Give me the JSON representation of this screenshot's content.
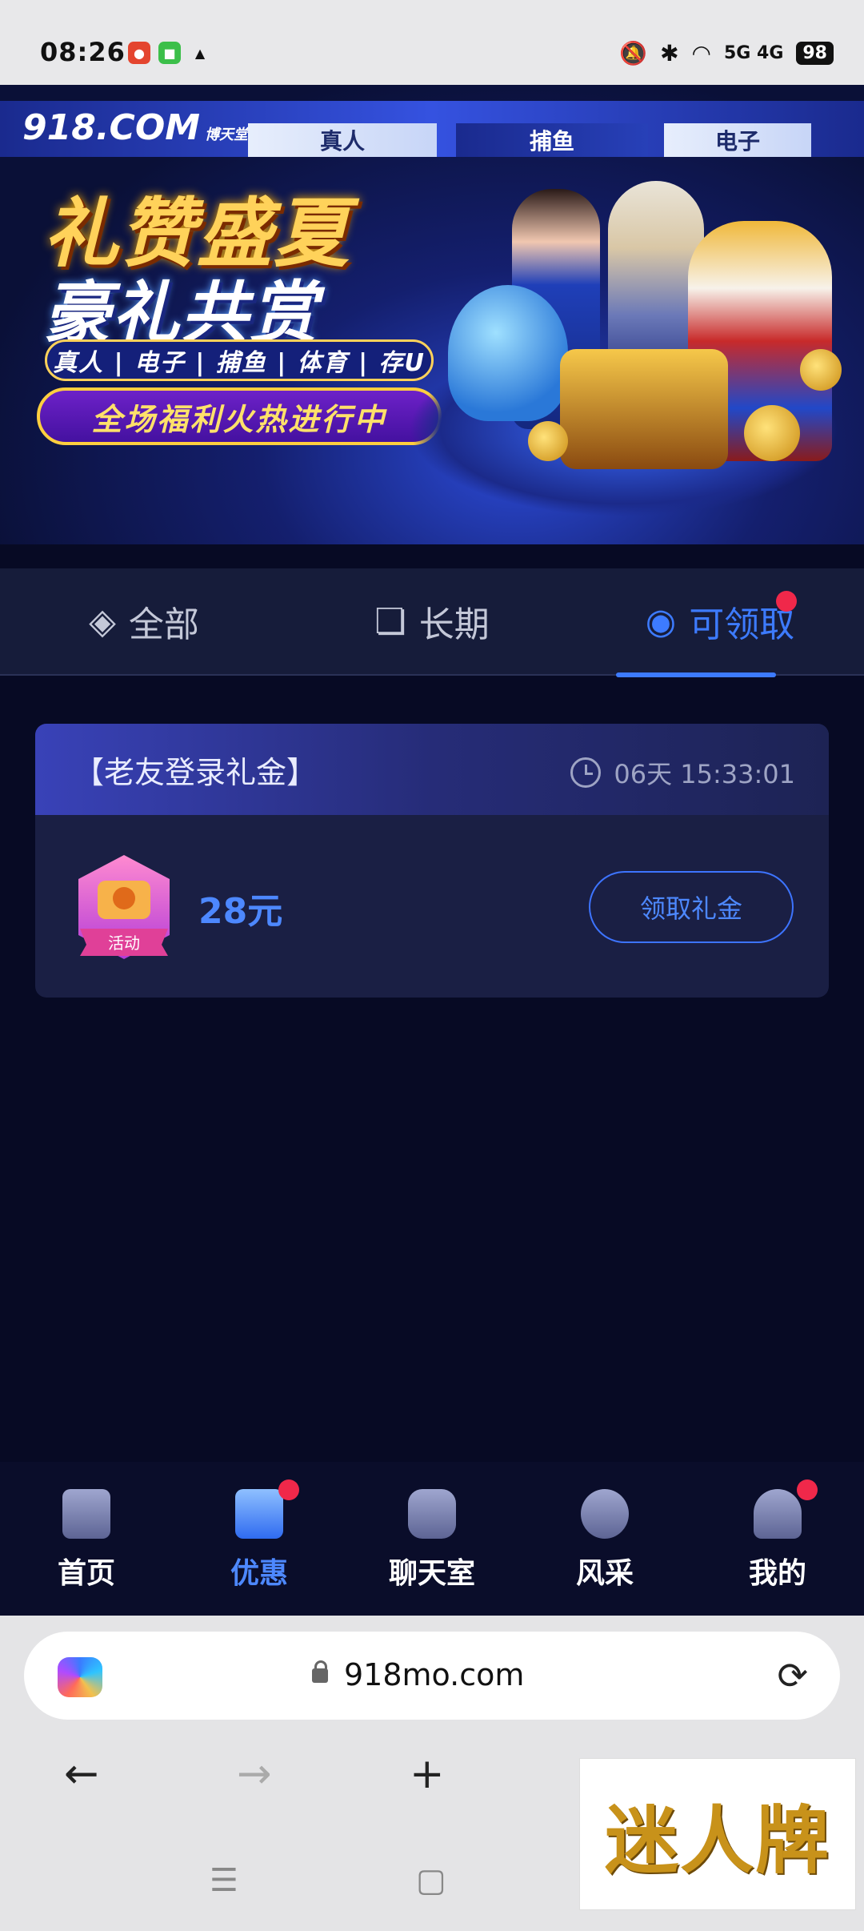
{
  "status_bar": {
    "time": "08:26",
    "network": "5G 4G",
    "battery": "98"
  },
  "banner": {
    "brand": "918.COM",
    "brand_sub": "博天堂",
    "categories_top": [
      "真人",
      "捕鱼",
      "电子"
    ],
    "headline_1": "礼赞盛夏",
    "headline_2": "豪礼共赏",
    "category_line": "真人 | 电子 | 捕鱼 | 体育 | 存U",
    "promo": "全场福利火热进行中"
  },
  "tabs": [
    {
      "label": "全部",
      "icon": "layers-icon"
    },
    {
      "label": "长期",
      "icon": "cards-icon"
    },
    {
      "label": "可领取",
      "icon": "coin-icon",
      "active": true,
      "has_dot": true
    }
  ],
  "card": {
    "title": "【老友登录礼金】",
    "countdown": "06天 15:33:01",
    "badge": "活动",
    "amount": "28元",
    "button": "领取礼金"
  },
  "bottom_nav": [
    {
      "label": "首页",
      "icon": "home-icon"
    },
    {
      "label": "优惠",
      "icon": "gift-icon",
      "active": true,
      "dot": true
    },
    {
      "label": "聊天室",
      "icon": "chat-icon"
    },
    {
      "label": "风采",
      "icon": "badge-icon"
    },
    {
      "label": "我的",
      "icon": "user-icon",
      "dot": true
    }
  ],
  "browser": {
    "url": "918mo.com"
  },
  "watermark": "迷人牌",
  "colors": {
    "accent": "#3d7bff",
    "background": "#070a24",
    "dot": "#f0284a"
  }
}
